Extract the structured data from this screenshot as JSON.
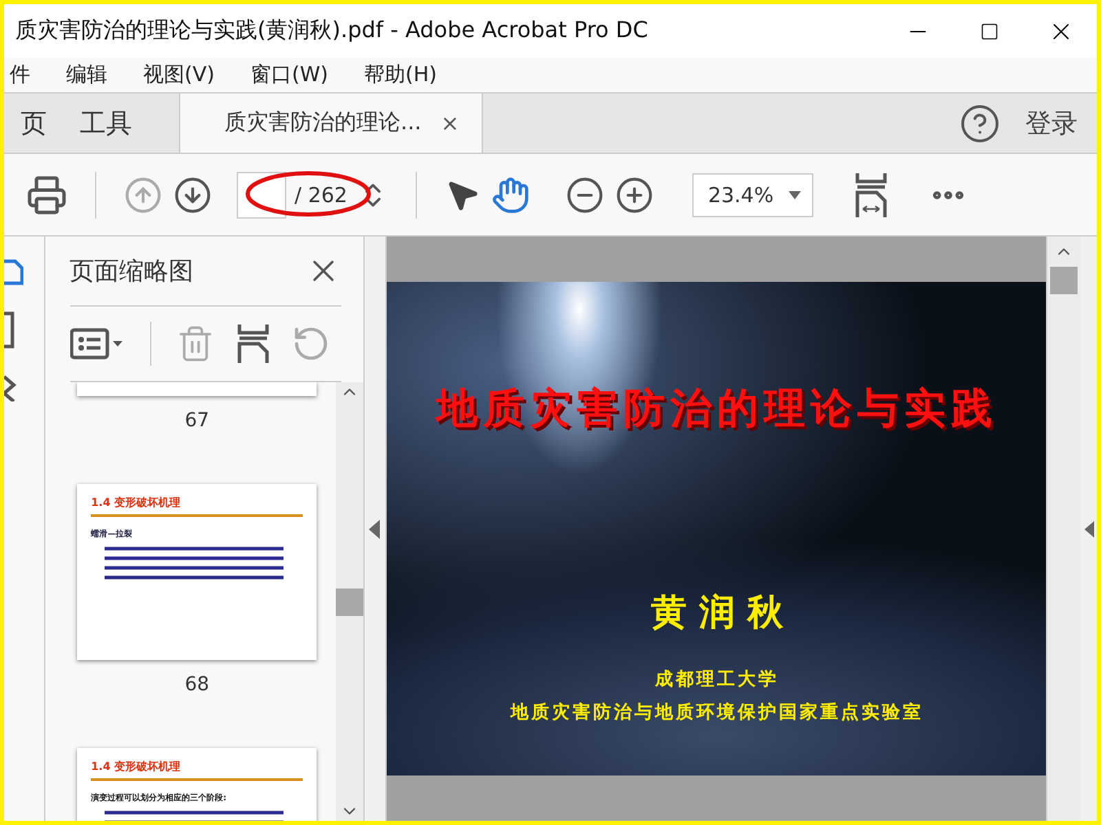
{
  "window": {
    "title": "质灾害防治的理论与实践(黄润秋).pdf - Adobe Acrobat Pro DC"
  },
  "menu": [
    "件",
    "编辑",
    "视图(V)",
    "窗口(W)",
    "帮助(H)"
  ],
  "tabs": [
    {
      "label": "页",
      "kind": "nav",
      "selected": false
    },
    {
      "label": "工具",
      "kind": "nav",
      "selected": false
    },
    {
      "label": "质灾害防治的理论...",
      "kind": "document",
      "selected": true,
      "close": "×"
    }
  ],
  "account": {
    "login": "登录"
  },
  "toolbar": {
    "page_total": "/ 262",
    "zoom": "23.4%",
    "tools": [
      {
        "kind": "select",
        "selected": false
      },
      {
        "kind": "hand",
        "selected": true
      }
    ]
  },
  "thumbnails_panel": {
    "title": "页面缩略图",
    "pages": [
      {
        "number": "67"
      },
      {
        "number": "68",
        "heading": "1.4 变形破坏机理",
        "subheading": "蠕滑—拉裂"
      },
      {
        "heading": "1.4 变形破坏机理",
        "first_line": "演变过程可以划分为相应的三个阶段:"
      }
    ]
  },
  "document": {
    "title": "地质灾害防治的理论与实践",
    "author": "黄 润 秋",
    "affiliation_lines": [
      "成都理工大学",
      "地质灾害防治与地质环境保护国家重点实验室"
    ]
  }
}
